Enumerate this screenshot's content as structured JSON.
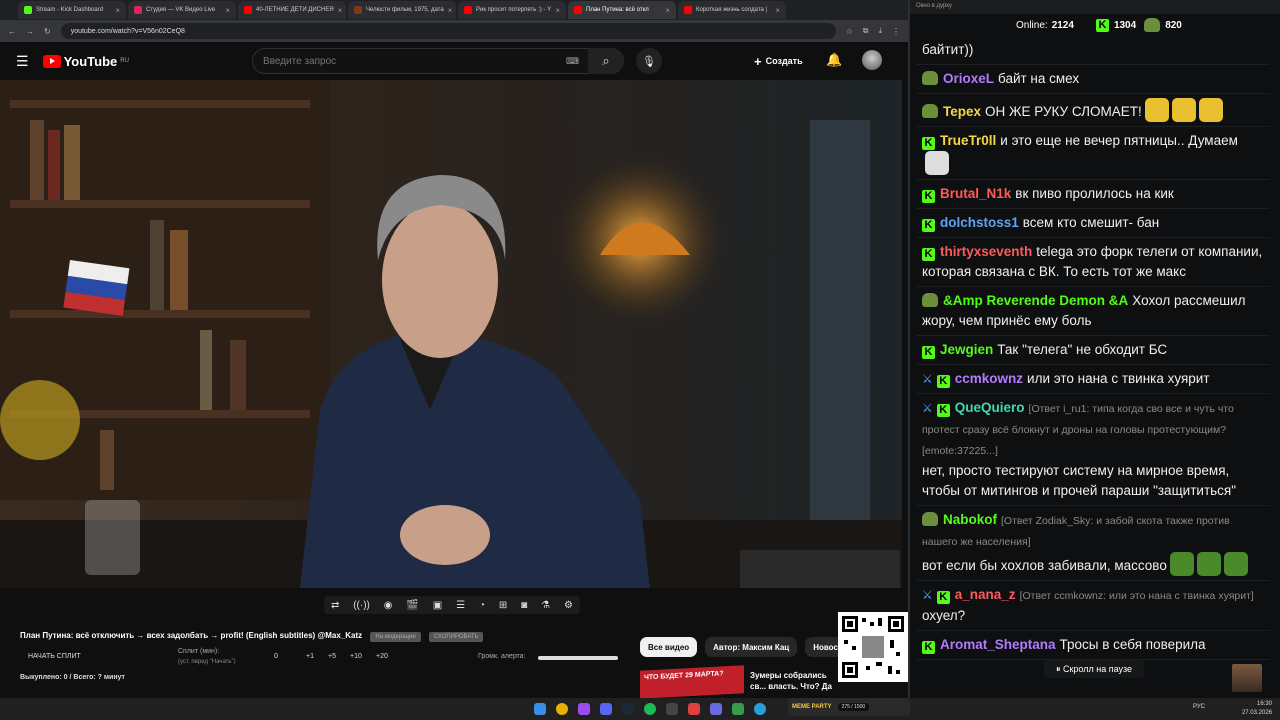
{
  "browser": {
    "tabs": [
      {
        "label": "Stream - Kick Dashboard",
        "color": "#53fc18"
      },
      {
        "label": "Студия — VK Видео Live",
        "color": "#e0245e"
      },
      {
        "label": "40-ЛЕТНИЕ ДЕТИ ДИСНЕЯ",
        "color": "#ff0000"
      },
      {
        "label": "Челюсти фильм, 1975, дата",
        "color": "#7a3a1a"
      },
      {
        "label": "Рик просит потерпеть :) - Y",
        "color": "#ff0000"
      },
      {
        "label": "План Путина: всё откл",
        "color": "#ff0000",
        "active": true
      },
      {
        "label": "Короткая жизнь солдата | ",
        "color": "#ff0000"
      }
    ],
    "url": "youtube.com/watch?v=V56n02CeQ8",
    "controls": [
      "–",
      "▢",
      "✕"
    ]
  },
  "youtube": {
    "logo": "YouTube",
    "region": "RU",
    "search_placeholder": "Введите запрос",
    "create_label": "Создать",
    "video_title": "План Путина: всё отключить → всех задолбать → profit! (English subtitles) @Max_Katz",
    "title_pills": [
      "На модерации",
      "СКОПИРОВАТЬ"
    ],
    "split": {
      "start_label": "НАЧАТЬ СПЛИТ",
      "minutes_label": "Сплит (мин):",
      "minutes_hint": "(уст. перед \"Начать\")",
      "value": "0",
      "increments": [
        "+1",
        "+5",
        "+10",
        "+20"
      ],
      "alert_label": "Громк. алерта:",
      "alert_level": 1.0,
      "bought_text": "Выкуплено: 0 / Всего: ? минут"
    },
    "chips": [
      "Все видео",
      "Автор: Максим Кац",
      "Новост"
    ],
    "suggested": {
      "thumb_text": "ЧТО БУДЕТ 29 МАРТА?",
      "title": "Зумеры собрались св... власть. Что? Да"
    },
    "player_controls": [
      "loop-icon",
      "broadcast-icon",
      "eye-icon",
      "clapper-icon",
      "pip-icon",
      "subtitles-icon",
      "speed-icon",
      "add-icon",
      "camera-icon",
      "flask-icon",
      "gear-icon"
    ]
  },
  "chat": {
    "window_title": "Окно в дурку",
    "online_label": "Online:",
    "online_count": "2124",
    "kick_count": "1304",
    "frog_count": "820",
    "paused_label": "⏸ Скролл на паузе",
    "messages": [
      {
        "user": "",
        "color": "#fff",
        "text": "байтит))"
      },
      {
        "user": "OrioxeL",
        "color": "#b37bff",
        "badge": "frog",
        "text": "байт на смех"
      },
      {
        "user": "Tepex",
        "color": "#f5d84a",
        "badge": "frog",
        "text": "ОН ЖЕ РУКУ СЛОМАЕТ!",
        "emotes": 3
      },
      {
        "user": "TrueTr0ll",
        "color": "#f5d84a",
        "badge": "kick",
        "text": "и это еще не вечер пятницы.. Думаем",
        "emotes": 1
      },
      {
        "user": "Brutal_N1k",
        "color": "#ff5b5b",
        "badge": "kick",
        "text": "вк пиво пролилось на кик"
      },
      {
        "user": "dolchstoss1",
        "color": "#5da4f5",
        "badge": "kick",
        "text": "всем кто смешит- бан"
      },
      {
        "user": "thirtyxseventh",
        "color": "#ff5b5b",
        "badge": "kick",
        "text": "telega это форк телеги от компании, которая связана с ВК. То есть тот же макс"
      },
      {
        "user": "&Amp Reverende Demon &A",
        "color": "#53fc18",
        "badge": "frog",
        "text": "Хохол рассмешил жору, чем принёс ему боль"
      },
      {
        "user": "Jewgien",
        "color": "#53fc18",
        "badge": "kick",
        "text": "Так \"телега\" не обходит БС"
      },
      {
        "user": "ccmkownz",
        "color": "#b37bff",
        "badge": "sword",
        "text": "или это нана с твинка хуярит"
      },
      {
        "user": "QueQuiero",
        "color": "#3fd8b0",
        "badge": "sword",
        "reply": "[Ответ i_ru1: типа когда сво все и чуть что протест сразу всё блокнут и дроны на головы протестующим? [emote:37225...]",
        "text": "нет, просто тестируют систему на мирное время, чтобы от митингов и прочей параши \"защититься\""
      },
      {
        "user": "Nabokof",
        "color": "#53fc18",
        "badge": "frog",
        "reply": "[Ответ Zodiak_Sky: и забой скота также против нашего же населения]",
        "text": "вот если бы хохлов забивали, массово",
        "emotes": 3
      },
      {
        "user": "a_nana_z",
        "color": "#ff5b5b",
        "badge": "sword",
        "reply": "[Ответ ccmkownz: или это нана с твинка хуярит]",
        "text": "охуел?"
      },
      {
        "user": "Aromat_Sheptana",
        "color": "#b37bff",
        "badge": "kick",
        "text": "Тросы в себя поверила"
      }
    ]
  },
  "taskbar": {
    "lang": "РУС",
    "time": "16:30",
    "date": "27.03.2026",
    "meme_party": "MEME PARTY",
    "meme_progress": "275 / 1500"
  }
}
